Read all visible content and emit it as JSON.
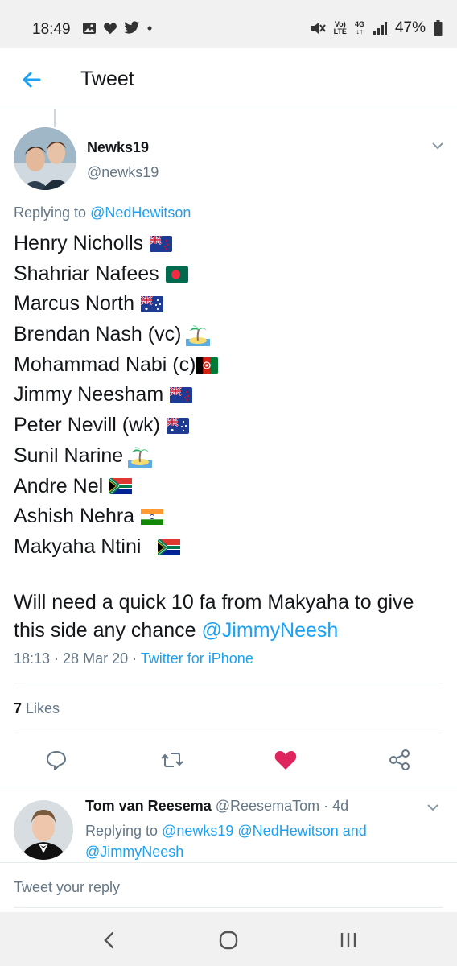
{
  "status_bar": {
    "time": "18:49",
    "network_top": "Vo)",
    "network_bottom": "LTE",
    "data_type_top": "4G",
    "data_type_bottom": "↓↑",
    "battery": "47%",
    "icons": [
      "gallery-icon",
      "heart-icon",
      "twitter-bird-icon",
      "dot-icon",
      "mute-icon",
      "signal-icon",
      "battery-icon"
    ]
  },
  "header": {
    "title": "Tweet",
    "back_icon": "arrow-left-icon",
    "accent": "#1da1f2"
  },
  "tweet": {
    "author_name": "Newks19",
    "author_handle": "@newks19",
    "replying_prefix": "Replying to ",
    "replying_to": "@NedHewitson",
    "lines": [
      {
        "text": "Henry Nicholls",
        "badge": "flag-new-zealand"
      },
      {
        "text": "Shahriar Nafees",
        "badge": "flag-bangladesh"
      },
      {
        "text": "Marcus North",
        "badge": "flag-australia"
      },
      {
        "text": "Brendan Nash (vc)",
        "badge": "island-emoji"
      },
      {
        "text": "Mohammad Nabi (c)",
        "badge": "flag-afghanistan"
      },
      {
        "text": "Jimmy Neesham",
        "badge": "flag-new-zealand"
      },
      {
        "text": "Peter Nevill (wk)",
        "badge": "flag-australia"
      },
      {
        "text": "Sunil Narine",
        "badge": "island-emoji"
      },
      {
        "text": "Andre Nel",
        "badge": "flag-south-africa"
      },
      {
        "text": "Ashish Nehra",
        "badge": "flag-india"
      },
      {
        "text": "Makyaha Ntini ",
        "badge": "flag-south-africa"
      }
    ],
    "closing_text": "Will need a quick 10 fa from Makyaha to give this side any chance ",
    "closing_mention": "@JimmyNeesh",
    "time": "18:13",
    "date": "28 Mar 20",
    "source": "Twitter for iPhone",
    "likes_count": "7",
    "likes_label": "Likes",
    "liked_color": "#e0245e"
  },
  "actions": {
    "reply_icon": "comment-icon",
    "retweet_icon": "retweet-icon",
    "like_icon": "heart-filled-icon",
    "share_icon": "share-icon"
  },
  "reply": {
    "author_name": "Tom van Reesema",
    "author_handle": "@ReesemaTom",
    "age": "4d",
    "replying_prefix": "Replying to ",
    "mention_1": "@newks19",
    "mention_2": "@NedHewitson",
    "and_word": " and ",
    "mention_3": "@JimmyNeesh"
  },
  "compose": {
    "placeholder": "Tweet your reply"
  },
  "nav": {
    "back": "nav-back-icon",
    "home": "nav-home-icon",
    "recents": "nav-recents-icon"
  }
}
